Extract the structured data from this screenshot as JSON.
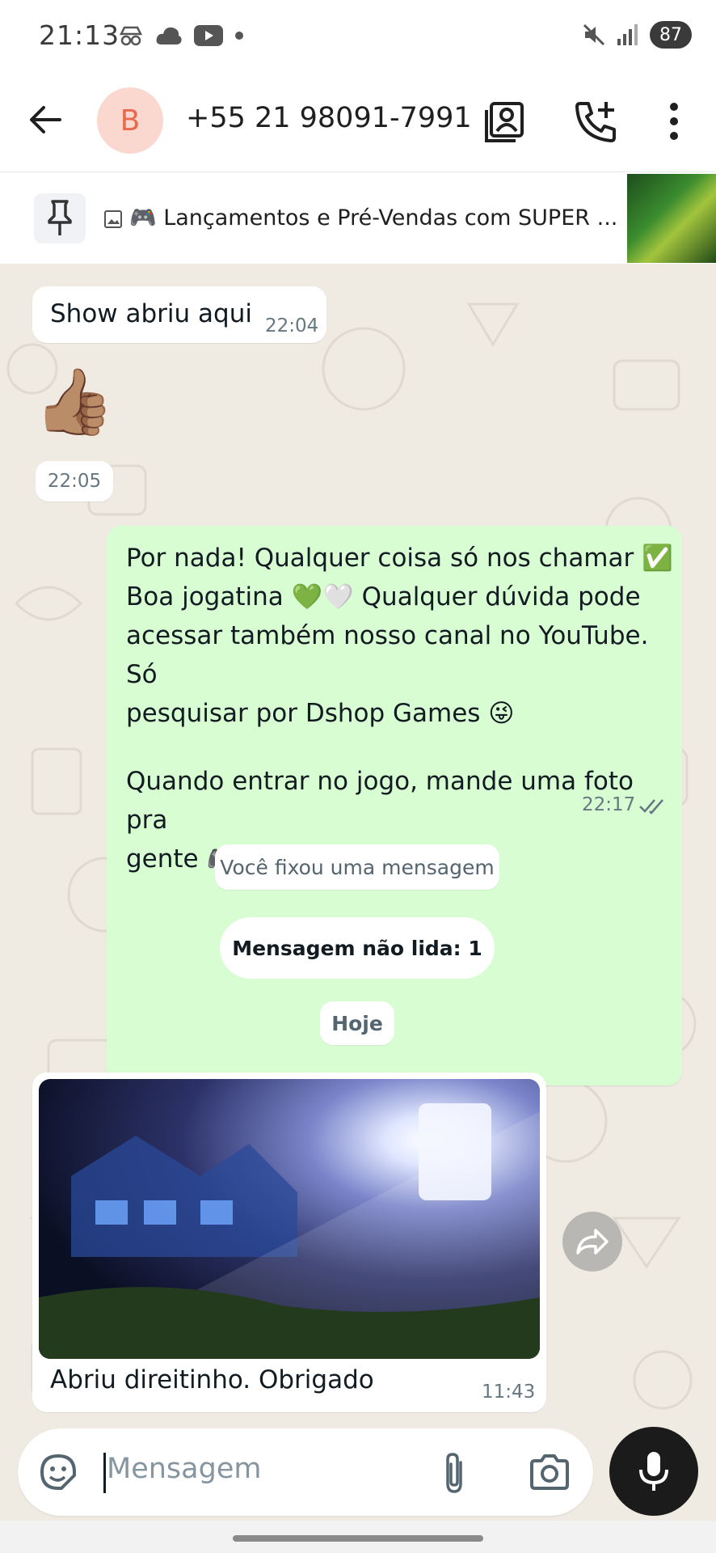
{
  "status_bar": {
    "time": "21:13",
    "battery": "87",
    "left_icons": [
      "incognito-icon",
      "cloud-icon",
      "youtube-icon",
      "dot-icon"
    ],
    "right_icons": [
      "mute-icon",
      "signal-icon",
      "battery-icon"
    ]
  },
  "header": {
    "avatar_letter": "B",
    "contact_name": "+55 21 98091-7991",
    "icons": [
      "back-arrow-icon",
      "contact-card-icon",
      "add-call-icon",
      "more-vert-icon"
    ]
  },
  "pinned": {
    "text": "🎮 Lançamentos e Pré-Vendas com SUPER ..."
  },
  "messages": {
    "m1": {
      "text": "Show abriu aqui",
      "time": "22:04"
    },
    "m2": {
      "emoji": "👍🏽",
      "time": "22:05"
    },
    "m3": {
      "line1": "Por nada! Qualquer coisa só nos chamar ✅",
      "line2": "Boa jogatina 💚🤍 Qualquer dúvida pode",
      "line3": "acessar também nosso canal  no YouTube.  Só",
      "line4": "pesquisar por Dshop Games 😜",
      "line5": "Quando entrar no jogo, mande uma foto pra",
      "line6": "gente 🎮📷",
      "time": "22:17"
    },
    "system_pinned": "Você fixou uma mensagem",
    "unread": "Mensagem não lida: 1",
    "date": "Hoje",
    "m4": {
      "caption": "Abriu direitinho. Obrigado",
      "time": "11:43"
    }
  },
  "input": {
    "placeholder": "Mensagem",
    "icons": [
      "sticker-icon",
      "attach-icon",
      "camera-icon",
      "mic-icon"
    ]
  },
  "colors": {
    "chat_bg": "#efeae2",
    "outgoing_bubble": "#d9fdd3",
    "incoming_bubble": "#ffffff",
    "read_ticks": "#667781"
  }
}
